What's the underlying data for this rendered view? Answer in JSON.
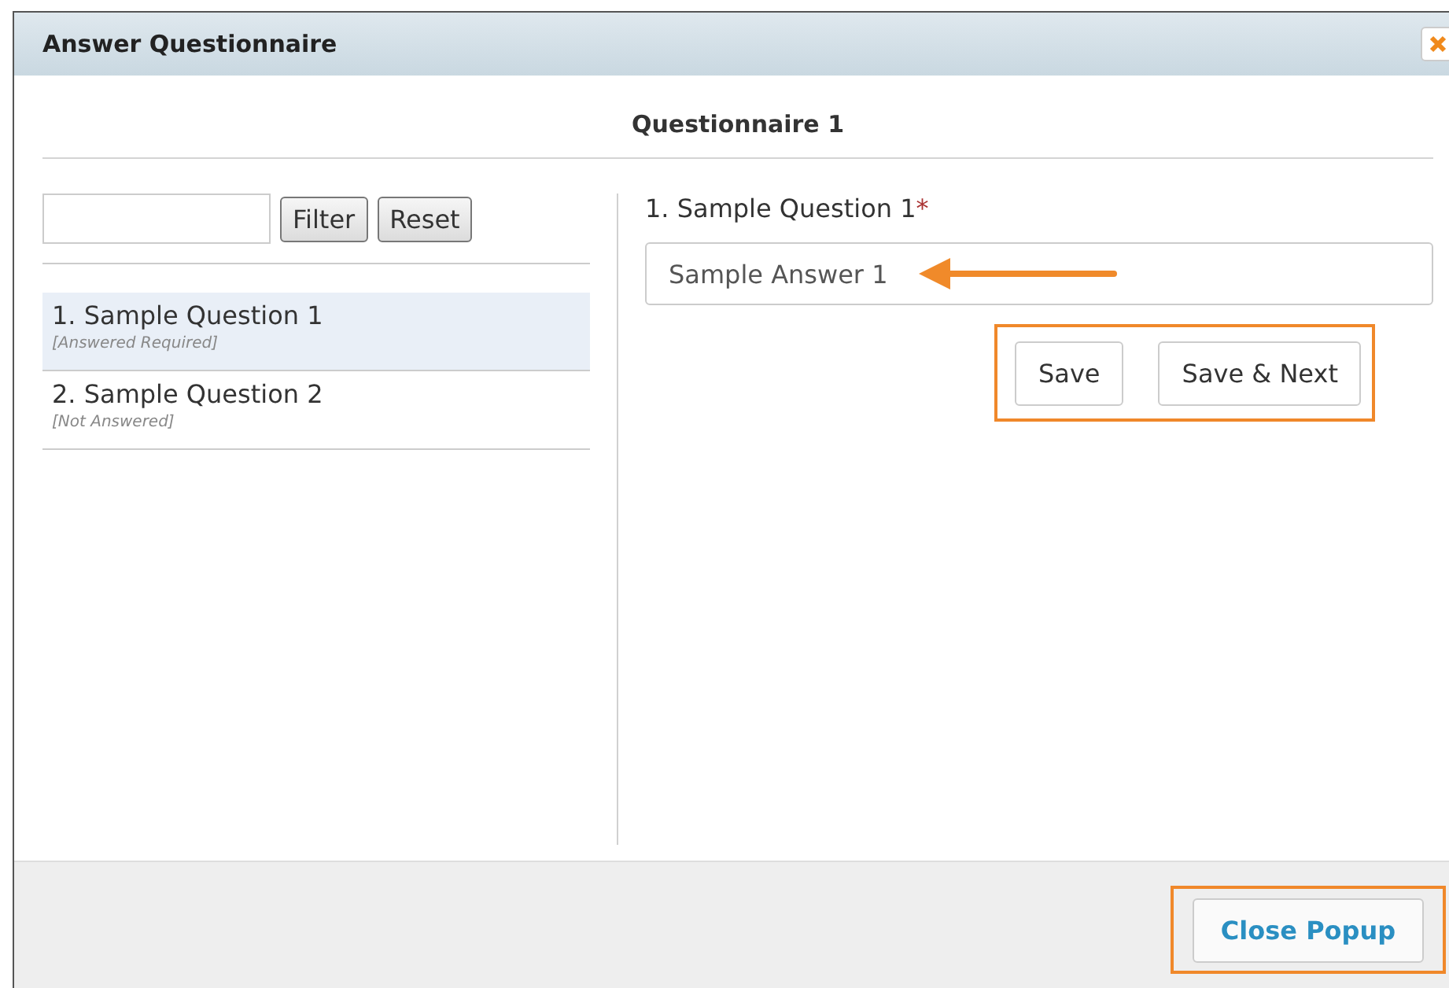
{
  "window": {
    "title": "Answer Questionnaire"
  },
  "heading": "Questionnaire 1",
  "filter": {
    "buttons": [
      "Filter",
      "Reset"
    ]
  },
  "questions": [
    {
      "title": "1. Sample Question 1",
      "status": "[Answered Required]",
      "selected": true
    },
    {
      "title": "2. Sample Question 2",
      "status": "[Not Answered]",
      "selected": false
    }
  ],
  "detail": {
    "label": "1. Sample Question 1",
    "required_mark": "*",
    "answer": "Sample Answer 1",
    "buttons": [
      "Save",
      "Save & Next"
    ]
  },
  "footer": {
    "close_button": "Close Popup"
  }
}
